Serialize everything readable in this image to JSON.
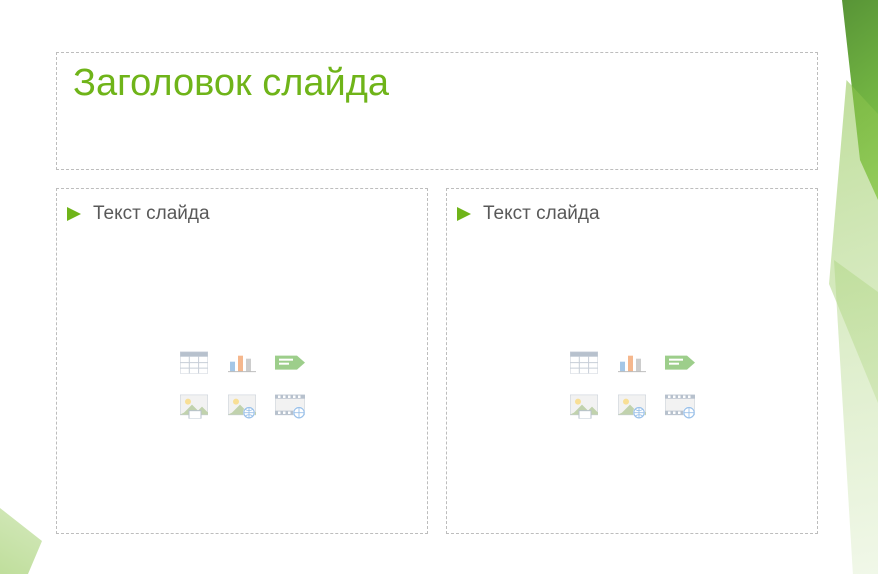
{
  "title": {
    "placeholder": "Заголовок слайда"
  },
  "content_left": {
    "placeholder": "Текст слайда",
    "insert_icons": {
      "table": "insert-table",
      "chart": "insert-chart",
      "smartart": "insert-smartart",
      "picture": "insert-picture",
      "online_picture": "insert-online-picture",
      "video": "insert-video"
    }
  },
  "content_right": {
    "placeholder": "Текст слайда",
    "insert_icons": {
      "table": "insert-table",
      "chart": "insert-chart",
      "smartart": "insert-smartart",
      "picture": "insert-picture",
      "online_picture": "insert-online-picture",
      "video": "insert-video"
    }
  },
  "theme": {
    "accent": "#6fb419",
    "body_text": "#595959",
    "placeholder_border": "#bdbdbd"
  }
}
